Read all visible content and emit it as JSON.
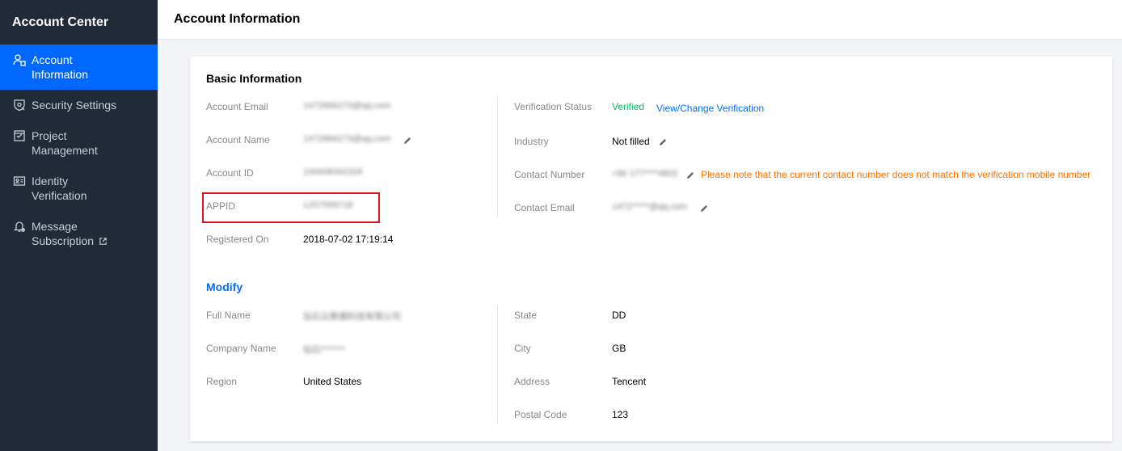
{
  "sidebar": {
    "title": "Account Center",
    "items": [
      {
        "label_1": "Account",
        "label_2": "Information"
      },
      {
        "label_1": "Security Settings"
      },
      {
        "label_1": "Project",
        "label_2": "Management"
      },
      {
        "label_1": "Identity",
        "label_2": "Verification"
      },
      {
        "label_1": "Message",
        "label_2": "Subscription"
      }
    ]
  },
  "header": {
    "title": "Account Information"
  },
  "basic": {
    "title": "Basic Information",
    "account_email": {
      "label": "Account Email",
      "value": "1472866273@qq.com"
    },
    "account_name": {
      "label": "Account Name",
      "value": "1472866273@qq.com"
    },
    "account_id": {
      "label": "Account ID",
      "value": "100008342328"
    },
    "appid": {
      "label": "APPID",
      "value": "1257559718"
    },
    "registered_on": {
      "label": "Registered On",
      "value": "2018-07-02 17:19:14"
    },
    "verification_status": {
      "label": "Verification Status",
      "value": "Verified",
      "link": "View/Change Verification"
    },
    "industry": {
      "label": "Industry",
      "value": "Not filled"
    },
    "contact_number": {
      "label": "Contact Number",
      "value": "+86 177****4802",
      "warning": "Please note that the current contact number does not match the verification mobile number"
    },
    "contact_email": {
      "label": "Contact Email",
      "value": "1472*****@qq.com"
    }
  },
  "modify": {
    "title": "Modify",
    "full_name": {
      "label": "Full Name",
      "value": "钻石云数据科技有限公司"
    },
    "company_name": {
      "label": "Company Name",
      "value": "钻石*******"
    },
    "region": {
      "label": "Region",
      "value": "United States"
    },
    "state": {
      "label": "State",
      "value": "DD"
    },
    "city": {
      "label": "City",
      "value": "GB"
    },
    "address": {
      "label": "Address",
      "value": "Tencent"
    },
    "postal_code": {
      "label": "Postal Code",
      "value": "123"
    }
  },
  "colors": {
    "sidebar_bg": "#212a36",
    "active": "#0068ff",
    "link": "#006eff",
    "verified": "#0abf5b",
    "warning": "#ff7200",
    "highlight": "#e0141e"
  },
  "icons": [
    "user-info-icon",
    "shield-icon",
    "project-icon",
    "id-card-icon",
    "bell-icon",
    "external-link-icon",
    "pencil-icon"
  ]
}
